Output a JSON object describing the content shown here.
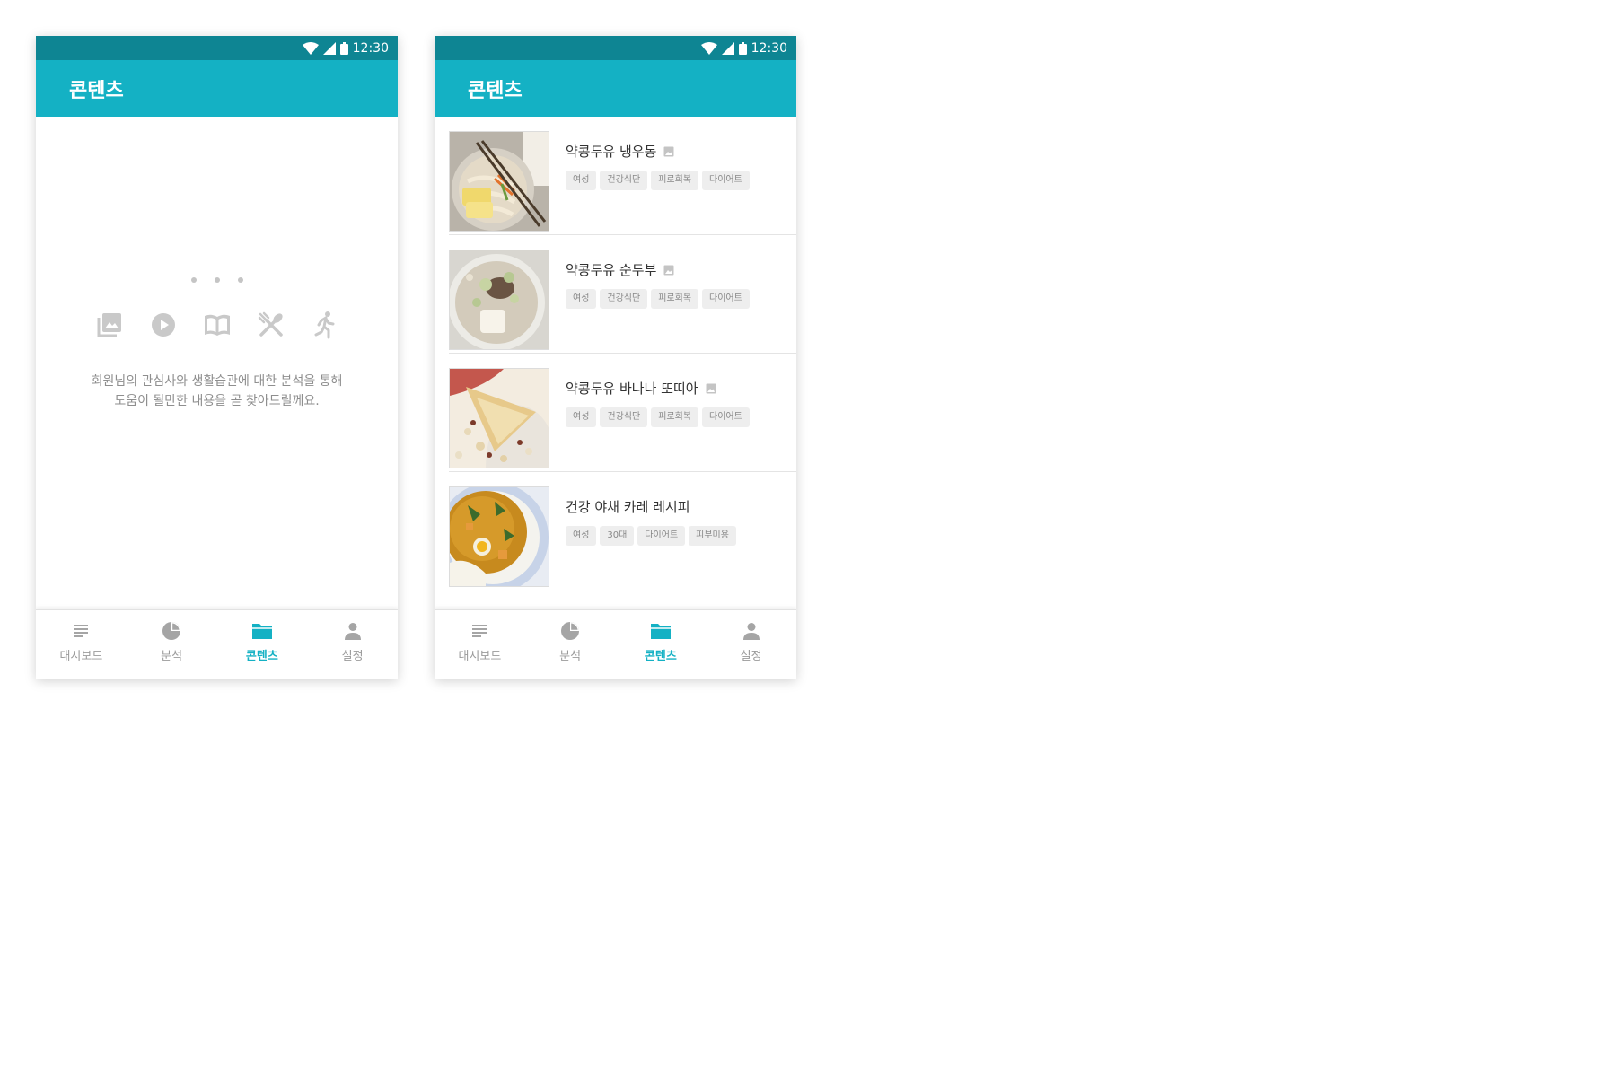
{
  "status": {
    "time": "12:30"
  },
  "screens": {
    "left": {
      "title": "콘텐츠",
      "empty_message_line1": "회원님의 관심사와 생활습관에 대한 분석을 통해",
      "empty_message_line2": "도움이 될만한 내용을 곧 찾아드릴께요.",
      "empty_icons": [
        "photo-library-icon",
        "play-circle-icon",
        "book-icon",
        "utensils-icon",
        "running-icon"
      ]
    },
    "right": {
      "title": "콘텐츠",
      "items": [
        {
          "title": "약콩두유 냉우동",
          "has_image_badge": true,
          "tags": [
            "여성",
            "건강식단",
            "피로회복",
            "다이어트"
          ]
        },
        {
          "title": "약콩두유 순두부",
          "has_image_badge": true,
          "tags": [
            "여성",
            "건강식단",
            "피로회복",
            "다이어트"
          ]
        },
        {
          "title": "약콩두유 바나나 또띠아",
          "has_image_badge": true,
          "tags": [
            "여성",
            "건강식단",
            "피로회복",
            "다이어트"
          ]
        },
        {
          "title": "건강 야채 카레 레시피",
          "has_image_badge": false,
          "tags": [
            "여성",
            "30대",
            "다이어트",
            "피부미용"
          ]
        }
      ]
    }
  },
  "nav": {
    "items": [
      {
        "label": "대시보드",
        "icon": "notes-icon"
      },
      {
        "label": "분석",
        "icon": "pie-chart-icon"
      },
      {
        "label": "콘텐츠",
        "icon": "folder-icon"
      },
      {
        "label": "설정",
        "icon": "person-icon"
      }
    ],
    "active_index": 2
  },
  "colors": {
    "statusbar": "#0e8593",
    "appbar": "#14b1c4",
    "accent": "#14b1c4",
    "inactive": "#9a9a9a"
  }
}
